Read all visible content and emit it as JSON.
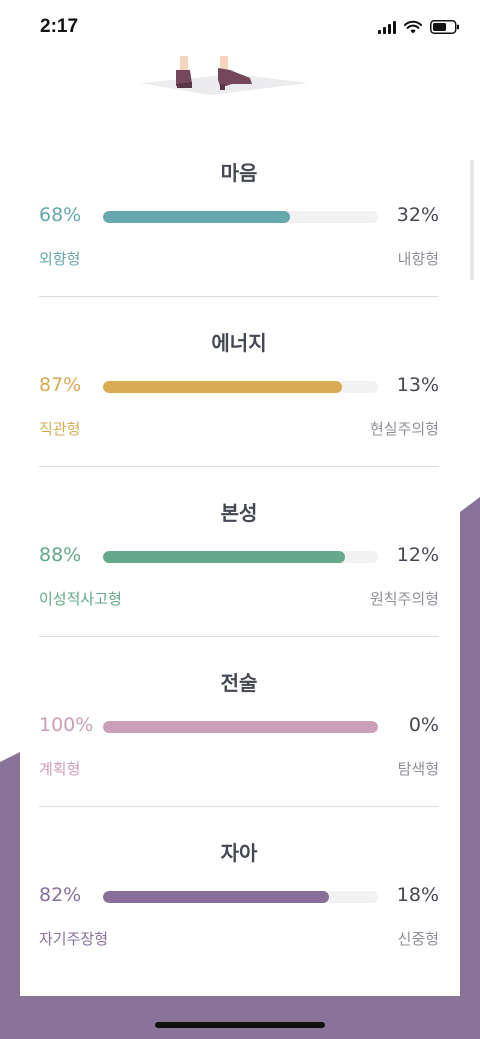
{
  "status_bar": {
    "time": "2:17"
  },
  "colors": {
    "background_shape": "#8a7399",
    "mind": "#67a8ad",
    "energy": "#d9ab55",
    "nature": "#64a98a",
    "tactics": "#cc9fb8",
    "identity": "#876f9a"
  },
  "sections": [
    {
      "title": "마음",
      "left_percent": "68%",
      "right_percent": "32%",
      "left_label": "외향형",
      "right_label": "내향형",
      "fill_fraction": 0.68
    },
    {
      "title": "에너지",
      "left_percent": "87%",
      "right_percent": "13%",
      "left_label": "직관형",
      "right_label": "현실주의형",
      "fill_fraction": 0.87
    },
    {
      "title": "본성",
      "left_percent": "88%",
      "right_percent": "12%",
      "left_label": "이성적사고형",
      "right_label": "원칙주의형",
      "fill_fraction": 0.88
    },
    {
      "title": "전술",
      "left_percent": "100%",
      "right_percent": "0%",
      "left_label": "계획형",
      "right_label": "탐색형",
      "fill_fraction": 1.0
    },
    {
      "title": "자아",
      "left_percent": "82%",
      "right_percent": "18%",
      "left_label": "자기주장형",
      "right_label": "신중형",
      "fill_fraction": 0.82
    }
  ]
}
